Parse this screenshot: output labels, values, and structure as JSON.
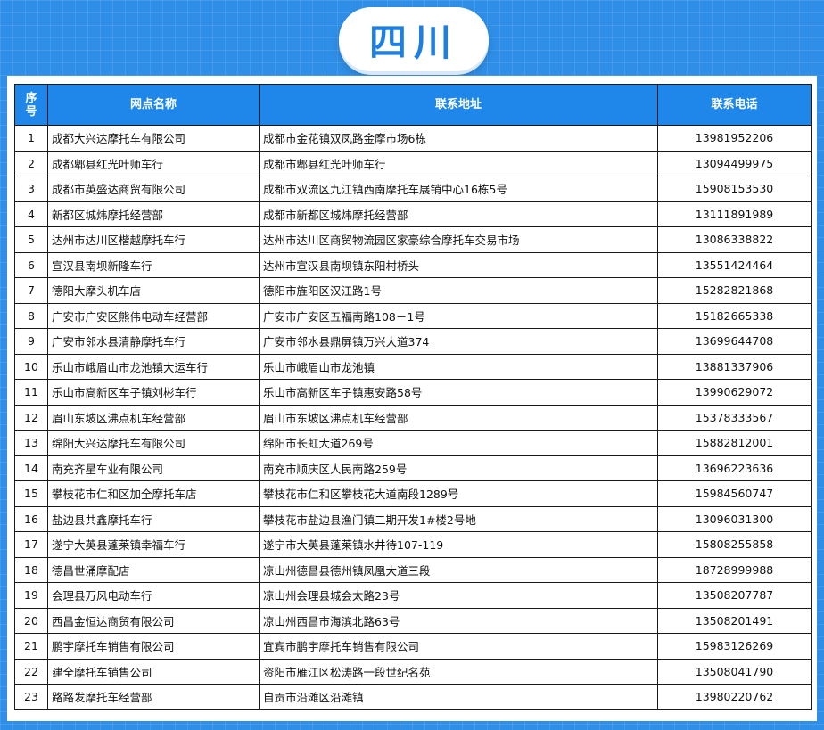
{
  "title": "四川",
  "table": {
    "headers": {
      "seq": "序号",
      "name": "网点名称",
      "address": "联系地址",
      "phone": "联系电话"
    },
    "rows": [
      {
        "seq": "1",
        "name": "成都大兴达摩托车有限公司",
        "address": "成都市金花镇双凤路金摩市场6栋",
        "phone": "13981952206"
      },
      {
        "seq": "2",
        "name": "成都郫县红光叶师车行",
        "address": "成都市郫县红光叶师车行",
        "phone": "13094499975"
      },
      {
        "seq": "3",
        "name": "成都市英盛达商贸有限公司",
        "address": "成都市双流区九江镇西南摩托车展销中心16栋5号",
        "phone": "15908153530"
      },
      {
        "seq": "4",
        "name": "新都区城炜摩托经营部",
        "address": "成都市新都区城炜摩托经营部",
        "phone": "13111891989"
      },
      {
        "seq": "5",
        "name": "达州市达川区楷越摩托车行",
        "address": "达州市达川区商贸物流园区家豪综合摩托车交易市场",
        "phone": "13086338822"
      },
      {
        "seq": "6",
        "name": "宣汉县南坝新隆车行",
        "address": "达州市宣汉县南坝镇东阳村桥头",
        "phone": "13551424464"
      },
      {
        "seq": "7",
        "name": "德阳大摩头机车店",
        "address": "德阳市旌阳区汉江路1号",
        "phone": "15282821868"
      },
      {
        "seq": "8",
        "name": "广安市广安区熊伟电动车经营部",
        "address": "广安市广安区五福南路108－1号",
        "phone": "15182665338"
      },
      {
        "seq": "9",
        "name": "广安市邻水县清静摩托车行",
        "address": "广安市邻水县鼎屏镇万兴大道374",
        "phone": "13699644708"
      },
      {
        "seq": "10",
        "name": "乐山市峨眉山市龙池镇大运车行",
        "address": "乐山市峨眉山市龙池镇",
        "phone": "13881337906"
      },
      {
        "seq": "11",
        "name": "乐山市高新区车子镇刘彬车行",
        "address": "乐山市高新区车子镇惠安路58号",
        "phone": "13990629072"
      },
      {
        "seq": "12",
        "name": "眉山东坡区沸点机车经营部",
        "address": "眉山市东坡区沸点机车经营部",
        "phone": "15378333567"
      },
      {
        "seq": "13",
        "name": "绵阳大兴达摩托车有限公司",
        "address": "绵阳市长虹大道269号",
        "phone": "15882812001"
      },
      {
        "seq": "14",
        "name": "南充齐星车业有限公司",
        "address": "南充市顺庆区人民南路259号",
        "phone": "13696223636"
      },
      {
        "seq": "15",
        "name": "攀枝花市仁和区加全摩托车店",
        "address": "攀枝花市仁和区攀枝花大道南段1289号",
        "phone": "15984560747"
      },
      {
        "seq": "16",
        "name": "盐边县共鑫摩托车行",
        "address": "攀枝花市盐边县渔门镇二期开发1#楼2号地",
        "phone": "13096031300"
      },
      {
        "seq": "17",
        "name": "遂宁大英县蓬莱镇幸福车行",
        "address": "遂宁市大英县蓬莱镇水井待107-119",
        "phone": "15808255858"
      },
      {
        "seq": "18",
        "name": "德昌世涌摩配店",
        "address": "凉山州德昌县德州镇凤凰大道三段",
        "phone": "18728999988"
      },
      {
        "seq": "19",
        "name": "会理县万风电动车行",
        "address": "凉山州会理县城会太路23号",
        "phone": "13508207787"
      },
      {
        "seq": "20",
        "name": "西昌金恒达商贸有限公司",
        "address": "凉山州西昌市海滨北路63号",
        "phone": "13508201491"
      },
      {
        "seq": "21",
        "name": "鹏宇摩托车销售有限公司",
        "address": "宜宾市鹏宇摩托车销售有限公司",
        "phone": "15983126269"
      },
      {
        "seq": "22",
        "name": "建全摩托车销售公司",
        "address": "资阳市雁江区松涛路一段世纪名苑",
        "phone": "13508041790"
      },
      {
        "seq": "23",
        "name": "路路发摩托车经营部",
        "address": "自贡市沿滩区沿滩镇",
        "phone": "13980220762"
      }
    ]
  }
}
